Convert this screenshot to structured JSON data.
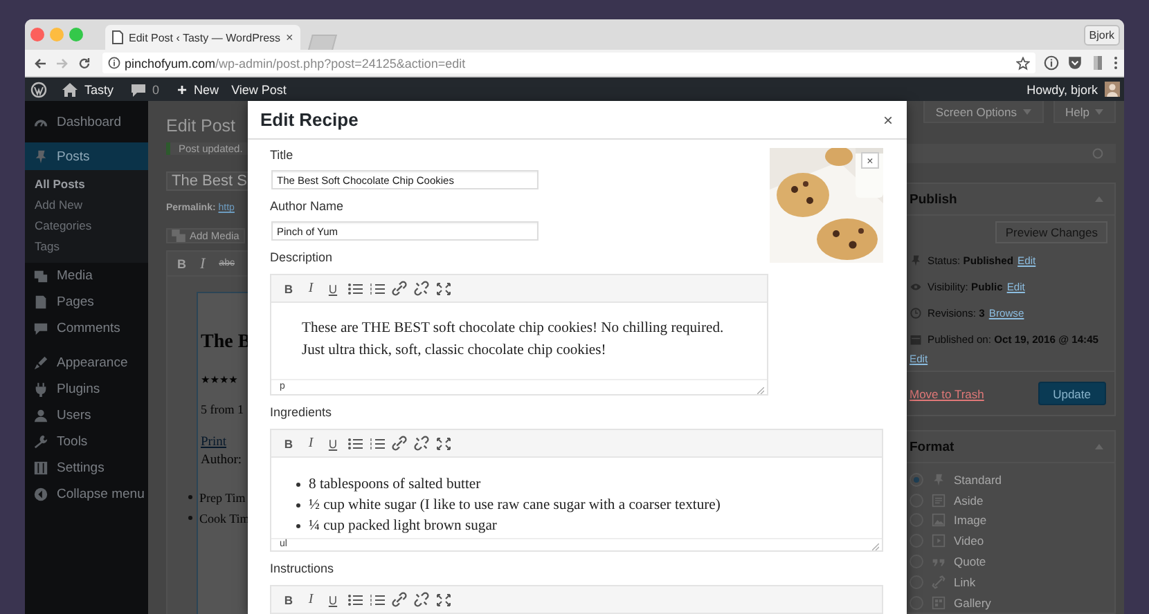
{
  "browser": {
    "tabs": [
      {
        "title": "Edit Post ‹ Tasty — WordPress",
        "close": "×",
        "selected": true
      }
    ],
    "profile": "Bjork",
    "url": {
      "domain": "pinchofyum.com",
      "path": "/wp-admin/post.php?post=24125&action=edit"
    }
  },
  "admin_bar": {
    "site": "Tasty",
    "comment_count": "0",
    "new_icon": "+",
    "new": "New",
    "view": "View Post",
    "greeting": "Howdy, bjork"
  },
  "sidebar": {
    "items": [
      {
        "label": "Dashboard",
        "selected": false
      },
      {
        "label": "Posts",
        "selected": true,
        "children": [
          {
            "label": "All Posts",
            "selected": true
          },
          {
            "label": "Add New",
            "selected": false
          },
          {
            "label": "Categories",
            "selected": false
          },
          {
            "label": "Tags",
            "selected": false
          }
        ]
      },
      {
        "label": "Media",
        "selected": false
      },
      {
        "label": "Pages",
        "selected": false
      },
      {
        "label": "Comments",
        "selected": false
      },
      {
        "label": "Appearance",
        "selected": false
      },
      {
        "label": "Plugins",
        "selected": false
      },
      {
        "label": "Users",
        "selected": false
      },
      {
        "label": "Tools",
        "selected": false
      },
      {
        "label": "Settings",
        "selected": false
      },
      {
        "label": "Collapse menu",
        "selected": false
      }
    ]
  },
  "page": {
    "title": "Edit Post",
    "screen_options": "Screen Options",
    "help": "Help",
    "notice": "Post updated.",
    "post_title": "The Best S",
    "permalink": {
      "label": "Permalink:",
      "url": "http"
    },
    "add_media": "Add Media",
    "toolbar": [
      {
        "kind": "bold",
        "label": "B"
      },
      {
        "kind": "italic",
        "label": "I"
      },
      {
        "kind": "strike",
        "label": "abc"
      }
    ],
    "content": {
      "heading": "The B",
      "rating": "★★★★",
      "rating_text": "5 from 1",
      "print": "Print",
      "author": "Author:",
      "list": [
        "Prep Tim",
        "Cook Tim"
      ]
    }
  },
  "publish": {
    "title": "Publish",
    "preview": "Preview Changes",
    "rows": [
      {
        "text": "Status: **Published**",
        "link": "Edit"
      },
      {
        "text": "Visibility: **Public**",
        "link": "Edit"
      },
      {
        "text": "Revisions: **3**",
        "link": "Browse"
      },
      {
        "text": "Published on: **Oct 19, 2016 @ 14:45**",
        "link": "Edit"
      }
    ],
    "trash": "Move to Trash",
    "update": "Update"
  },
  "format": {
    "title": "Format",
    "options": [
      {
        "label": "Standard",
        "selected": true
      },
      {
        "label": "Aside",
        "selected": false
      },
      {
        "label": "Image",
        "selected": false
      },
      {
        "label": "Video",
        "selected": false
      },
      {
        "label": "Quote",
        "selected": false
      },
      {
        "label": "Link",
        "selected": false
      },
      {
        "label": "Gallery",
        "selected": false
      }
    ]
  },
  "modal": {
    "title": "Edit Recipe",
    "close": "×",
    "image_close": "×",
    "fields": [
      {
        "label": "Title",
        "value": "The Best Soft Chocolate Chip Cookies"
      },
      {
        "label": "Author Name",
        "value": "Pinch of Yum"
      }
    ],
    "description": {
      "label": "Description",
      "toolbar": [
        {
          "kind": "bold",
          "label": "B"
        },
        {
          "kind": "italic",
          "label": "I"
        },
        {
          "kind": "underline",
          "label": "U"
        },
        {
          "kind": "bullet-list"
        },
        {
          "kind": "number-list"
        },
        {
          "kind": "link"
        },
        {
          "kind": "unlink"
        },
        {
          "kind": "fullscreen"
        }
      ],
      "text": "These are THE BEST soft chocolate chip cookies! No chilling required. Just ultra thick, soft, classic chocolate chip cookies!",
      "path": "p"
    },
    "ingredients": {
      "label": "Ingredients",
      "toolbar": [
        {
          "kind": "bold",
          "label": "B"
        },
        {
          "kind": "italic",
          "label": "I"
        },
        {
          "kind": "underline",
          "label": "U"
        },
        {
          "kind": "bullet-list"
        },
        {
          "kind": "number-list"
        },
        {
          "kind": "link"
        },
        {
          "kind": "unlink"
        },
        {
          "kind": "fullscreen"
        }
      ],
      "items": [
        "8 tablespoons of salted butter",
        "½ cup white sugar (I like to use raw cane sugar with a coarser texture)",
        "¼ cup packed light brown sugar"
      ],
      "path": "ul"
    },
    "instructions": {
      "label": "Instructions",
      "toolbar": [
        {
          "kind": "bold",
          "label": "B"
        },
        {
          "kind": "italic",
          "label": "I"
        },
        {
          "kind": "underline",
          "label": "U"
        },
        {
          "kind": "bullet-list"
        },
        {
          "kind": "number-list"
        },
        {
          "kind": "link"
        },
        {
          "kind": "unlink"
        },
        {
          "kind": "fullscreen"
        }
      ]
    }
  }
}
